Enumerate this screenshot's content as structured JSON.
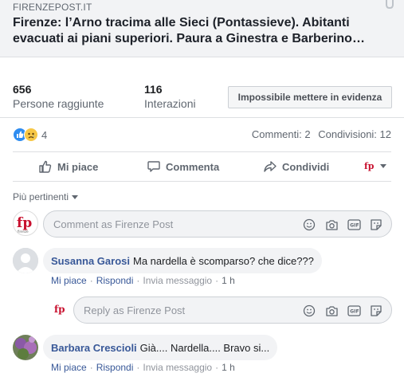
{
  "link": {
    "domain": "FIRENZEPOST.IT",
    "title": "Firenze: l’Arno tracima alle Sieci (Pontassieve). Abitanti evacuati ai piani superiori. Paura a Ginestra e Barberino…"
  },
  "stats": {
    "reach_value": "656",
    "reach_label": "Persone raggiunte",
    "engagement_value": "116",
    "engagement_label": "Interazioni",
    "boost_label": "Impossibile mettere in evidenza"
  },
  "reactions": {
    "count": "4",
    "icons": [
      "like-icon",
      "sad-icon"
    ],
    "comments": "Commenti: 2",
    "shares": "Condivisioni: 12"
  },
  "actions": {
    "like": "Mi piace",
    "comment": "Commenta",
    "share": "Condividi"
  },
  "sort_label": "Più pertinenti",
  "composer": {
    "placeholder": "Comment as Firenze Post"
  },
  "comments": [
    {
      "author": "Susanna Garosi",
      "text": "Ma nardella è scomparso? che dice???",
      "like": "Mi piace",
      "reply": "Rispondi",
      "message": "Invia messaggio",
      "time": "1 h"
    },
    {
      "author": "Barbara Crescioli",
      "text": "Già.... Nardella.... Bravo si...",
      "like": "Mi piace",
      "reply": "Rispondi",
      "message": "Invia messaggio",
      "time": "1 h"
    }
  ],
  "reply_composer": {
    "placeholder": "Reply as Firenze Post"
  },
  "colors": {
    "accent": "#385898",
    "like_blue": "#2e8cf0",
    "brand_red": "#c8102e"
  }
}
